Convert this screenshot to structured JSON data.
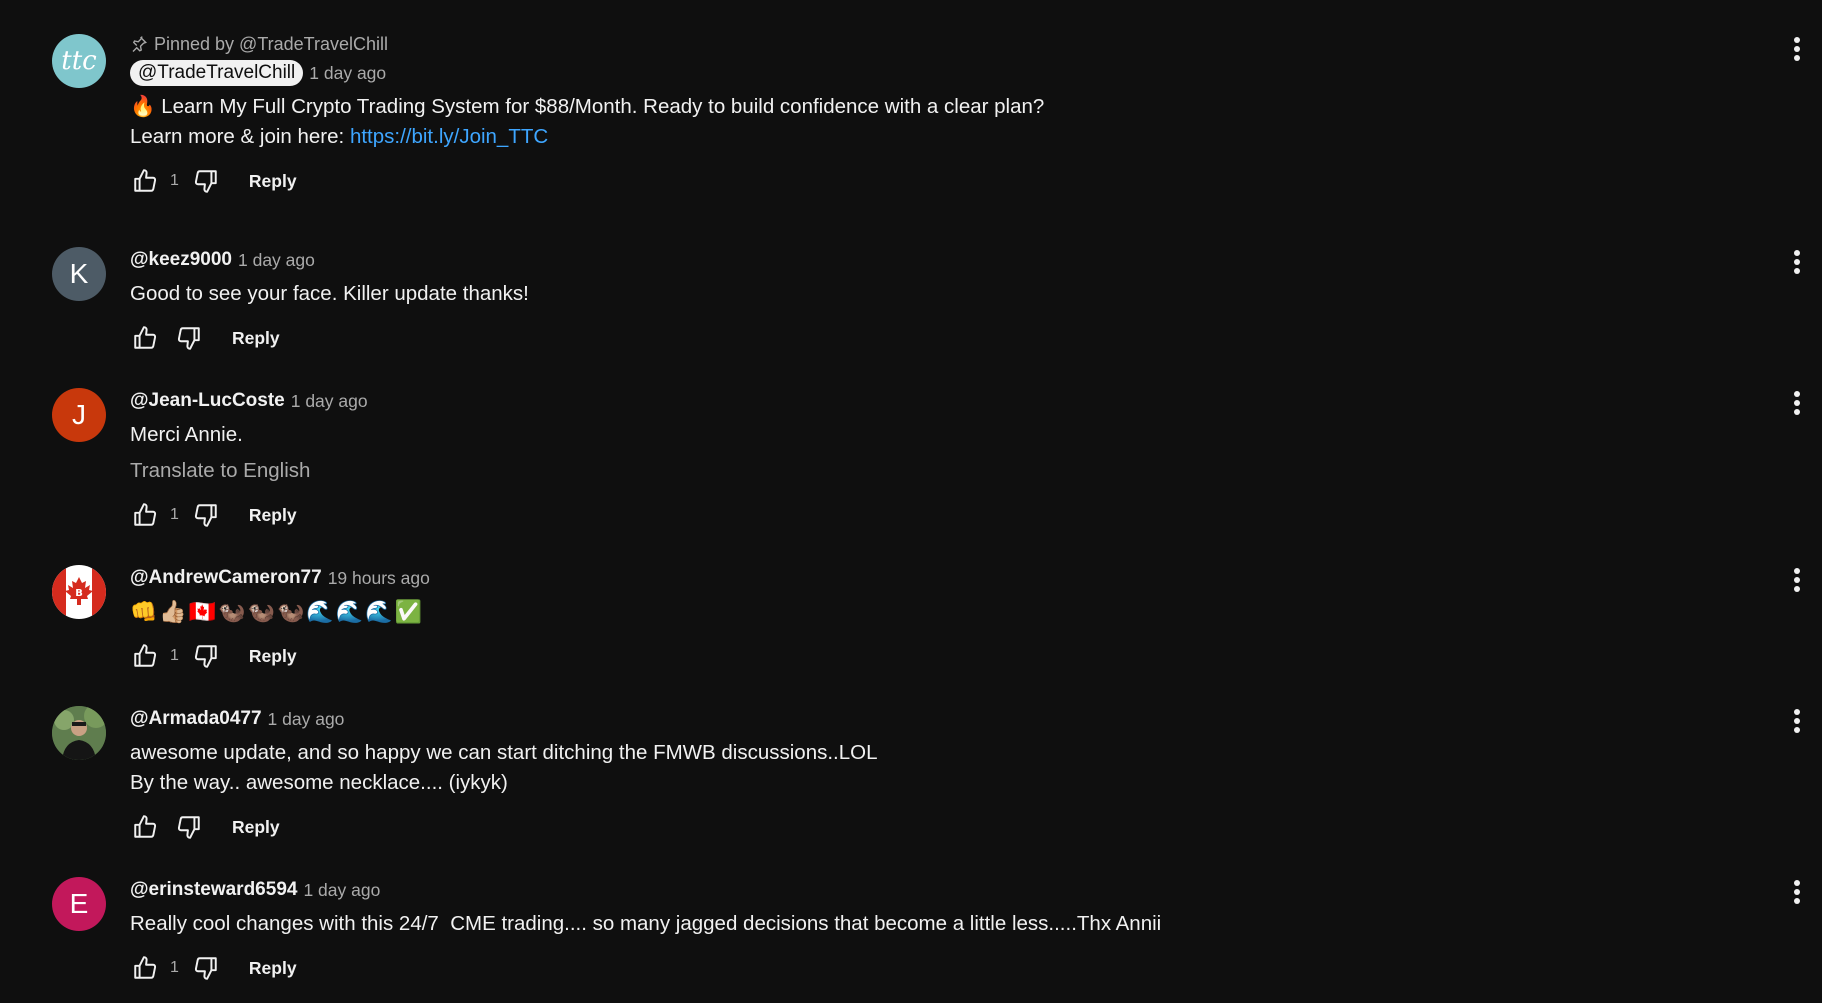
{
  "comments": [
    {
      "avatar_letter": "",
      "avatar_text": "ttc",
      "avatar_color": "#7fc6cc",
      "pinned_text": "Pinned by @TradeTravelChill",
      "author": "@TradeTravelChill",
      "time": "1 day ago",
      "line1": "🔥 Learn My Full Crypto Trading System for $88/Month. Ready to build confidence with a clear plan?",
      "line2_prefix": "Learn more & join here: ",
      "link": "https://bit.ly/Join_TTC",
      "likes": "1",
      "reply_label": "Reply"
    },
    {
      "avatar_letter": "K",
      "avatar_color": "#4d5b66",
      "author": "@keez9000",
      "time": "1 day ago",
      "text": "Good to see your face. Killer update thanks!",
      "likes": "",
      "reply_label": "Reply"
    },
    {
      "avatar_letter": "J",
      "avatar_color": "#c8380c",
      "author": "@Jean-LucCoste",
      "time": "1 day ago",
      "text": "Merci Annie.",
      "translate": "Translate to English",
      "likes": "1",
      "reply_label": "Reply"
    },
    {
      "avatar_letter": "",
      "avatar_color": "#ffffff",
      "author": "@AndrewCameron77",
      "time": "19 hours ago",
      "text": "👊👍🏼🇨🇦🦦🦦🦦🌊🌊🌊✅",
      "likes": "1",
      "reply_label": "Reply"
    },
    {
      "avatar_letter": "",
      "avatar_color": "#3f5a3a",
      "author": "@Armada0477",
      "time": "1 day ago",
      "text": "awesome update, and so happy we can start ditching the FMWB discussions..LOL\nBy the way.. awesome necklace.... (iykyk)",
      "likes": "",
      "reply_label": "Reply"
    },
    {
      "avatar_letter": "E",
      "avatar_color": "#c2185b",
      "author": "@erinsteward6594",
      "time": "1 day ago",
      "text": "Really cool changes with this 24/7  CME trading.... so many jagged decisions that become a little less.....Thx Annii",
      "likes": "1",
      "reply_label": "Reply"
    }
  ]
}
